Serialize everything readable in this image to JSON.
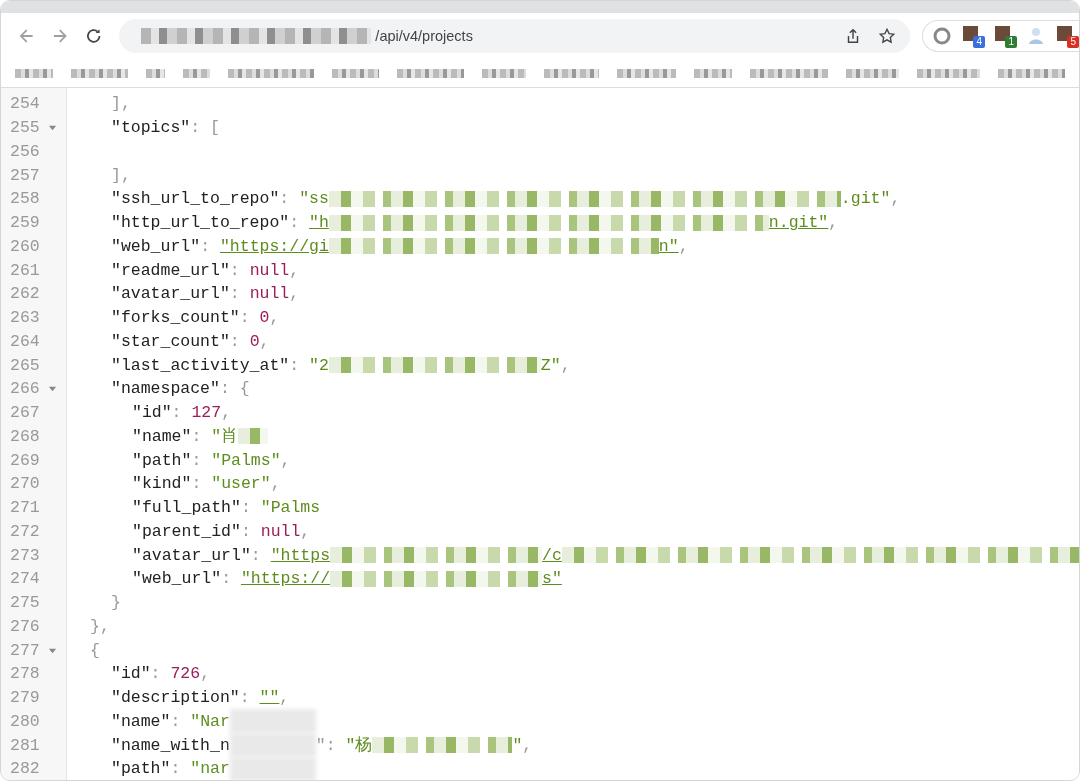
{
  "browser": {
    "address": "/api/v4/projects",
    "extensions": [
      {
        "kind": "circle"
      },
      {
        "kind": "square",
        "badge": "4",
        "color": "#3a6fdc"
      },
      {
        "kind": "square",
        "badge": "1",
        "color": "#2e7d32"
      },
      {
        "kind": "figure"
      },
      {
        "kind": "square",
        "badge": "5",
        "color": "#d93025"
      }
    ]
  },
  "code": [
    {
      "children": [
        {
          "line": "254",
          "tokens": [
            {
              "kind": "punct",
              "text": "],"
            }
          ]
        },
        {
          "line": "255",
          "expanded": true,
          "tokens": [
            {
              "kind": "key",
              "text": "\"topics\""
            },
            {
              "kind": "punct",
              "text": ": ["
            }
          ],
          "children": [
            {
              "line": "256"
            }
          ]
        },
        {
          "line": "257",
          "tokens": [
            {
              "kind": "punct",
              "text": "],"
            }
          ]
        },
        {
          "line": "258",
          "tokens": [
            {
              "kind": "key",
              "text": "\"ssh_url_to_repo\""
            },
            {
              "kind": "punct",
              "text": ": "
            },
            {
              "kind": "string",
              "text": "\"ss"
            },
            {
              "kind": "redacted"
            },
            {
              "kind": "string",
              "text": ".git\""
            },
            {
              "kind": "punct",
              "text": ","
            }
          ]
        },
        {
          "line": "259",
          "tokens": [
            {
              "kind": "key",
              "text": "\"http_url_to_repo\""
            },
            {
              "kind": "punct",
              "text": ": "
            },
            {
              "kind": "link",
              "text": "\"h"
            },
            {
              "kind": "redacted"
            },
            {
              "kind": "link",
              "text": "n.git\""
            },
            {
              "kind": "punct",
              "text": ","
            }
          ]
        },
        {
          "line": "260",
          "tokens": [
            {
              "kind": "key",
              "text": "\"web_url\""
            },
            {
              "kind": "punct",
              "text": ": "
            },
            {
              "kind": "link",
              "text": "\"https://gi"
            },
            {
              "kind": "redacted"
            },
            {
              "kind": "link",
              "text": "n\""
            },
            {
              "kind": "punct",
              "text": ","
            }
          ]
        },
        {
          "line": "261",
          "tokens": [
            {
              "kind": "key",
              "text": "\"readme_url\""
            },
            {
              "kind": "punct",
              "text": ": "
            },
            {
              "kind": "null",
              "text": "null"
            },
            {
              "kind": "punct",
              "text": ","
            }
          ]
        },
        {
          "line": "262",
          "tokens": [
            {
              "kind": "key",
              "text": "\"avatar_url\""
            },
            {
              "kind": "punct",
              "text": ": "
            },
            {
              "kind": "null",
              "text": "null"
            },
            {
              "kind": "punct",
              "text": ","
            }
          ]
        },
        {
          "line": "263",
          "tokens": [
            {
              "kind": "key",
              "text": "\"forks_count\""
            },
            {
              "kind": "punct",
              "text": ": "
            },
            {
              "kind": "number",
              "text": "0"
            },
            {
              "kind": "punct",
              "text": ","
            }
          ]
        },
        {
          "line": "264",
          "tokens": [
            {
              "kind": "key",
              "text": "\"star_count\""
            },
            {
              "kind": "punct",
              "text": ": "
            },
            {
              "kind": "number",
              "text": "0"
            },
            {
              "kind": "punct",
              "text": ","
            }
          ]
        },
        {
          "line": "265",
          "tokens": [
            {
              "kind": "key",
              "text": "\"last_activity_at\""
            },
            {
              "kind": "punct",
              "text": ": "
            },
            {
              "kind": "string",
              "text": "\"2"
            },
            {
              "kind": "redacted"
            },
            {
              "kind": "string",
              "text": "Z\""
            },
            {
              "kind": "punct",
              "text": ","
            }
          ]
        },
        {
          "line": "266",
          "expanded": true,
          "tokens": [
            {
              "kind": "key",
              "text": "\"namespace\""
            },
            {
              "kind": "punct",
              "text": ": {"
            }
          ],
          "children": [
            {
              "line": "267",
              "tokens": [
                {
                  "kind": "key",
                  "text": "\"id\""
                },
                {
                  "kind": "punct",
                  "text": ": "
                },
                {
                  "kind": "number",
                  "text": "127"
                },
                {
                  "kind": "punct",
                  "text": ","
                }
              ]
            },
            {
              "line": "268",
              "tokens": [
                {
                  "kind": "key",
                  "text": "\"name\""
                },
                {
                  "kind": "punct",
                  "text": ": "
                },
                {
                  "kind": "string",
                  "text": "\"肖"
                },
                {
                  "kind": "redacted"
                }
              ]
            },
            {
              "line": "269",
              "tokens": [
                {
                  "kind": "key",
                  "text": "\"path\""
                },
                {
                  "kind": "punct",
                  "text": ": "
                },
                {
                  "kind": "string",
                  "text": "\"Palms\""
                },
                {
                  "kind": "punct",
                  "text": ","
                }
              ]
            },
            {
              "line": "270",
              "tokens": [
                {
                  "kind": "key",
                  "text": "\"kind\""
                },
                {
                  "kind": "punct",
                  "text": ": "
                },
                {
                  "kind": "string",
                  "text": "\"user\""
                },
                {
                  "kind": "punct",
                  "text": ","
                }
              ]
            },
            {
              "line": "271",
              "tokens": [
                {
                  "kind": "key",
                  "text": "\"full_path\""
                },
                {
                  "kind": "punct",
                  "text": ": "
                },
                {
                  "kind": "string",
                  "text": "\"Palms"
                }
              ]
            },
            {
              "line": "272",
              "tokens": [
                {
                  "kind": "key",
                  "text": "\"parent_id\""
                },
                {
                  "kind": "punct",
                  "text": ": "
                },
                {
                  "kind": "null",
                  "text": "null"
                },
                {
                  "kind": "punct",
                  "text": ","
                }
              ]
            },
            {
              "line": "273",
              "tokens": [
                {
                  "kind": "key",
                  "text": "\"avatar_url\""
                },
                {
                  "kind": "punct",
                  "text": ": "
                },
                {
                  "kind": "link",
                  "text": "\"https"
                },
                {
                  "kind": "redacted"
                },
                {
                  "kind": "link",
                  "text": "/c"
                },
                {
                  "kind": "redacted"
                }
              ]
            },
            {
              "line": "274",
              "tokens": [
                {
                  "kind": "key",
                  "text": "\"web_url\""
                },
                {
                  "kind": "punct",
                  "text": ": "
                },
                {
                  "kind": "link",
                  "text": "\"https://"
                },
                {
                  "kind": "redacted"
                },
                {
                  "kind": "link",
                  "text": "s\""
                }
              ]
            }
          ]
        },
        {
          "line": "275",
          "tokens": [
            {
              "kind": "punct",
              "text": "}"
            }
          ]
        }
      ]
    },
    {
      "line": "276",
      "tokens": [
        {
          "kind": "punct",
          "text": "},"
        }
      ]
    },
    {
      "line": "277",
      "expanded": true,
      "tokens": [
        {
          "kind": "punct",
          "text": "{"
        }
      ],
      "children": [
        {
          "line": "278",
          "tokens": [
            {
              "kind": "key",
              "text": "\"id\""
            },
            {
              "kind": "punct",
              "text": ": "
            },
            {
              "kind": "number",
              "text": "726"
            },
            {
              "kind": "punct",
              "text": ","
            }
          ]
        },
        {
          "line": "279",
          "tokens": [
            {
              "kind": "key",
              "text": "\"description\""
            },
            {
              "kind": "punct",
              "text": ": "
            },
            {
              "kind": "link",
              "text": "\"\""
            },
            {
              "kind": "punct",
              "text": ","
            }
          ]
        },
        {
          "line": "280",
          "tokens": [
            {
              "kind": "key",
              "text": "\"name\""
            },
            {
              "kind": "punct",
              "text": ": "
            },
            {
              "kind": "string",
              "text": "\"Nar"
            },
            {
              "kind": "blur"
            }
          ]
        },
        {
          "line": "281",
          "tokens": [
            {
              "kind": "key",
              "text": "\"name_with_n"
            },
            {
              "kind": "blur"
            },
            {
              "kind": "punct",
              "text": "\": "
            },
            {
              "kind": "string",
              "text": "\"杨"
            },
            {
              "kind": "redacted"
            },
            {
              "kind": "string",
              "text": "\""
            },
            {
              "kind": "punct",
              "text": ","
            }
          ]
        },
        {
          "line": "282",
          "tokens": [
            {
              "kind": "key",
              "text": "\"path\""
            },
            {
              "kind": "punct",
              "text": ": "
            },
            {
              "kind": "string",
              "text": "\"nar"
            },
            {
              "kind": "blur"
            }
          ]
        }
      ]
    }
  ]
}
